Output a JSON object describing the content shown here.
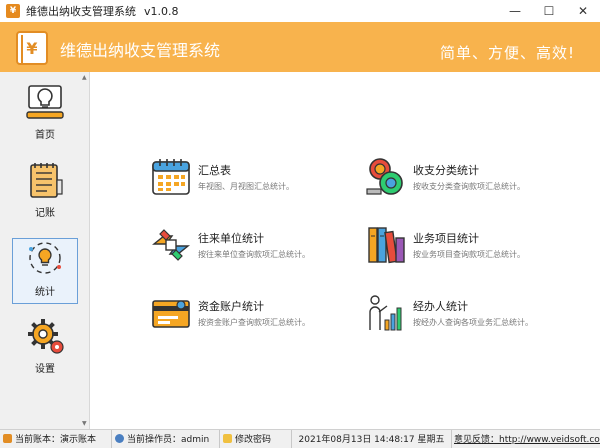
{
  "window": {
    "title": "维德出纳收支管理系统",
    "version": "v1.0.8",
    "min_glyph": "—",
    "max_glyph": "☐",
    "close_glyph": "✕"
  },
  "header": {
    "logo_glyph": "¥",
    "title": "维德出纳收支管理系统",
    "slogan": "简单、方便、高效!"
  },
  "sidebar": {
    "items": [
      {
        "label": "首页",
        "icon": "lightbulb-icon",
        "active": false
      },
      {
        "label": "记账",
        "icon": "notepad-icon",
        "active": false
      },
      {
        "label": "统计",
        "icon": "bulb-cycle-icon",
        "active": true
      },
      {
        "label": "设置",
        "icon": "gear-icon",
        "active": false
      }
    ]
  },
  "cards": [
    {
      "title": "汇总表",
      "desc": "年视图、月视图汇总统计。",
      "icon": "calendar-icon"
    },
    {
      "title": "收支分类统计",
      "desc": "按收支分类查询款项汇总统计。",
      "icon": "coins-icon"
    },
    {
      "title": "往来单位统计",
      "desc": "按往来单位查询款项汇总统计。",
      "icon": "handshake-icon"
    },
    {
      "title": "业务项目统计",
      "desc": "按业务项目查询款项汇总统计。",
      "icon": "binders-icon"
    },
    {
      "title": "资金账户统计",
      "desc": "按资金账户查询款项汇总统计。",
      "icon": "bank-card-icon"
    },
    {
      "title": "经办人统计",
      "desc": "按经办人查询各项业务汇总统计。",
      "icon": "presenter-icon"
    }
  ],
  "status": {
    "account": "当前账本：演示账本",
    "operator": "当前操作员：admin",
    "change_password": "修改密码",
    "datetime": "2021年08月13日 14:48:17 星期五",
    "feedback": "意见反馈：http://www.veidsoft.com"
  },
  "colors": {
    "header": "#f8b34d",
    "accent": "#e28d24",
    "active_border": "#6a9fd8"
  }
}
